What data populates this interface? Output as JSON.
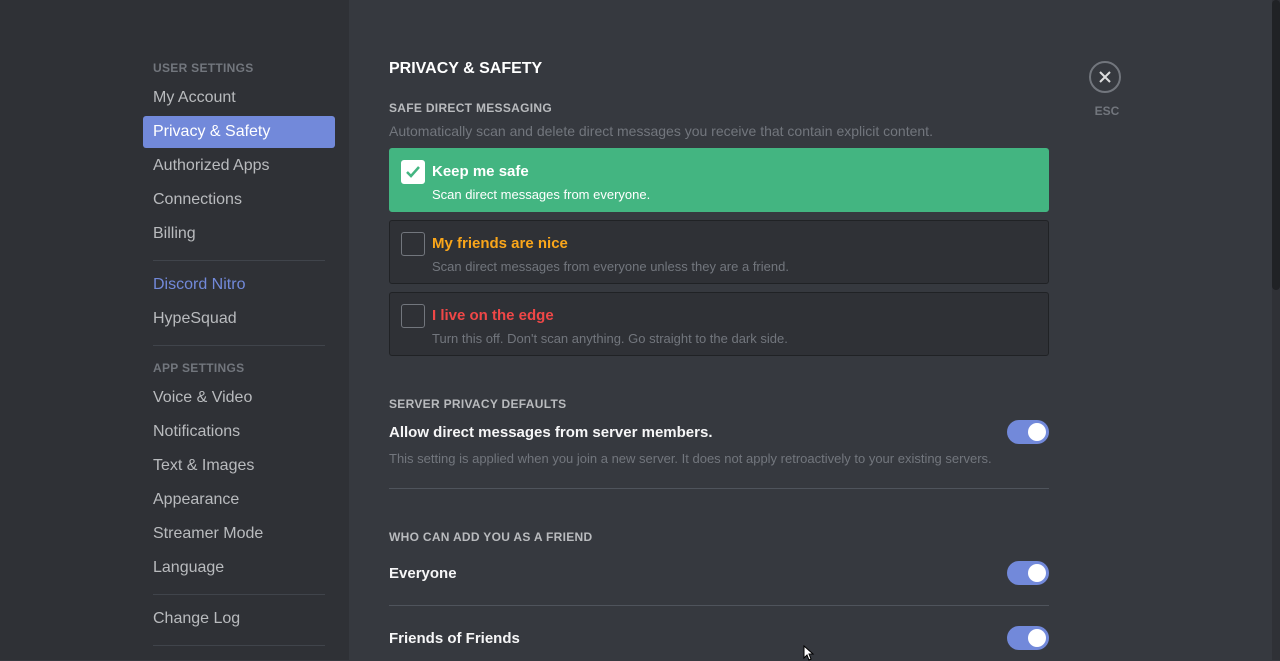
{
  "sidebar": {
    "user_settings_header": "USER SETTINGS",
    "user_items": [
      "My Account",
      "Privacy & Safety",
      "Authorized Apps",
      "Connections",
      "Billing"
    ],
    "nitro": "Discord Nitro",
    "hypesquad": "HypeSquad",
    "app_settings_header": "APP SETTINGS",
    "app_items": [
      "Voice & Video",
      "Notifications",
      "Text & Images",
      "Appearance",
      "Streamer Mode",
      "Language"
    ],
    "changelog": "Change Log",
    "active_item": "Privacy & Safety"
  },
  "main": {
    "title": "PRIVACY & SAFETY",
    "safe_dm": {
      "header": "SAFE DIRECT MESSAGING",
      "description": "Automatically scan and delete direct messages you receive that contain explicit content.",
      "options": [
        {
          "title": "Keep me safe",
          "desc": "Scan direct messages from everyone.",
          "selected": true,
          "color": "#ffffff"
        },
        {
          "title": "My friends are nice",
          "desc": "Scan direct messages from everyone unless they are a friend.",
          "selected": false,
          "color": "#faa61a"
        },
        {
          "title": "I live on the edge",
          "desc": "Turn this off. Don't scan anything. Go straight to the dark side.",
          "selected": false,
          "color": "#f04747"
        }
      ]
    },
    "server_privacy": {
      "header": "SERVER PRIVACY DEFAULTS",
      "label": "Allow direct messages from server members.",
      "note": "This setting is applied when you join a new server. It does not apply retroactively to your existing servers.",
      "enabled": true
    },
    "friend_requests": {
      "header": "WHO CAN ADD YOU AS A FRIEND",
      "items": [
        {
          "label": "Everyone",
          "enabled": true
        },
        {
          "label": "Friends of Friends",
          "enabled": true
        }
      ]
    },
    "close": {
      "label": "ESC",
      "icon": "close-icon"
    }
  },
  "colors": {
    "accent": "#7289da",
    "success": "#43b581",
    "warning": "#faa61a",
    "danger": "#f04747"
  }
}
